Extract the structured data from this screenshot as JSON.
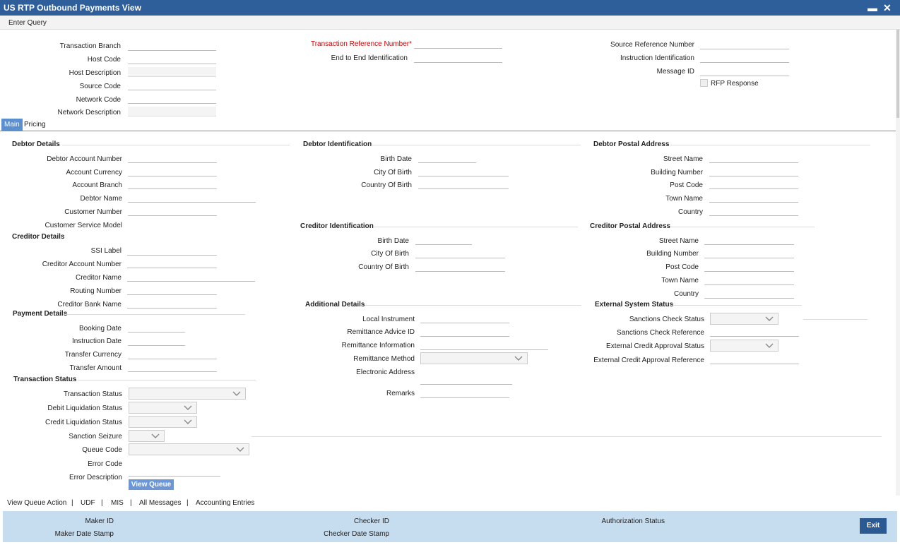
{
  "window": {
    "title": "US RTP Outbound Payments View",
    "minimize": "▬",
    "close": "✕"
  },
  "toolbar": {
    "enter_query": "Enter Query"
  },
  "header": {
    "transaction_branch": "Transaction Branch",
    "host_code": "Host Code",
    "host_description": "Host Description",
    "source_code": "Source Code",
    "network_code": "Network Code",
    "network_description": "Network Description",
    "txn_ref_number": "Transaction Reference Number",
    "required_mark": "*",
    "e2e_id": "End to End Identification",
    "source_ref_number": "Source Reference Number",
    "instruction_id": "Instruction Identification",
    "message_id": "Message ID",
    "rfp_response": "RFP Response"
  },
  "tabs": {
    "main": "Main",
    "pricing": "Pricing"
  },
  "debtor_details": {
    "title": "Debtor Details",
    "account_number": "Debtor Account Number",
    "account_currency": "Account Currency",
    "account_branch": "Account Branch",
    "debtor_name": "Debtor Name",
    "customer_number": "Customer Number",
    "customer_service_model": "Customer Service Model"
  },
  "debtor_identification": {
    "title": "Debtor Identification",
    "birth_date": "Birth Date",
    "city_of_birth": "City Of Birth",
    "country_of_birth": "Country Of Birth"
  },
  "debtor_postal": {
    "title": "Debtor Postal Address",
    "street_name": "Street Name",
    "building_number": "Building Number",
    "post_code": "Post Code",
    "town_name": "Town Name",
    "country": "Country"
  },
  "creditor_details": {
    "title": "Creditor Details",
    "ssi_label": "SSI Label",
    "account_number": "Creditor Account Number",
    "creditor_name": "Creditor Name",
    "routing_number": "Routing Number",
    "bank_name": "Creditor Bank Name"
  },
  "creditor_identification": {
    "title": "Creditor Identification",
    "birth_date": "Birth Date",
    "city_of_birth": "City Of Birth",
    "country_of_birth": "Country Of Birth"
  },
  "creditor_postal": {
    "title": "Creditor Postal Address",
    "street_name": "Street Name",
    "building_number": "Building Number",
    "post_code": "Post Code",
    "town_name": "Town Name",
    "country": "Country"
  },
  "payment_details": {
    "title": "Payment Details",
    "booking_date": "Booking Date",
    "instruction_date": "Instruction Date",
    "transfer_currency": "Transfer Currency",
    "transfer_amount": "Transfer Amount"
  },
  "additional_details": {
    "title": "Additional Details",
    "local_instrument": "Local Instrument",
    "remittance_advice_id": "Remittance Advice ID",
    "remittance_information": "Remittance Information",
    "remittance_method": "Remittance Method",
    "electronic_address": "Electronic Address",
    "remarks": "Remarks"
  },
  "external_system_status": {
    "title": "External System Status",
    "sanctions_check_status": "Sanctions Check Status",
    "sanctions_check_reference": "Sanctions Check Reference",
    "external_credit_approval_status": "External Credit Approval Status",
    "external_credit_approval_reference": "External Credit Approval Reference"
  },
  "transaction_status": {
    "title": "Transaction Status",
    "transaction_status": "Transaction Status",
    "debit_liquidation_status": "Debit Liquidation Status",
    "credit_liquidation_status": "Credit Liquidation Status",
    "sanction_seizure": "Sanction Seizure",
    "queue_code": "Queue Code",
    "error_code": "Error Code",
    "error_description": "Error Description",
    "view_queue": "View Queue"
  },
  "links": {
    "view_queue_action": "View Queue Action",
    "udf": "UDF",
    "mis": "MIS",
    "all_messages": "All Messages",
    "accounting_entries": "Accounting Entries",
    "sep": "|"
  },
  "footer": {
    "maker_id": "Maker ID",
    "maker_date_stamp": "Maker Date Stamp",
    "checker_id": "Checker ID",
    "checker_date_stamp": "Checker Date Stamp",
    "authorization_status": "Authorization Status",
    "exit": "Exit"
  },
  "icons": {
    "chevron": "chevron-down-icon"
  }
}
